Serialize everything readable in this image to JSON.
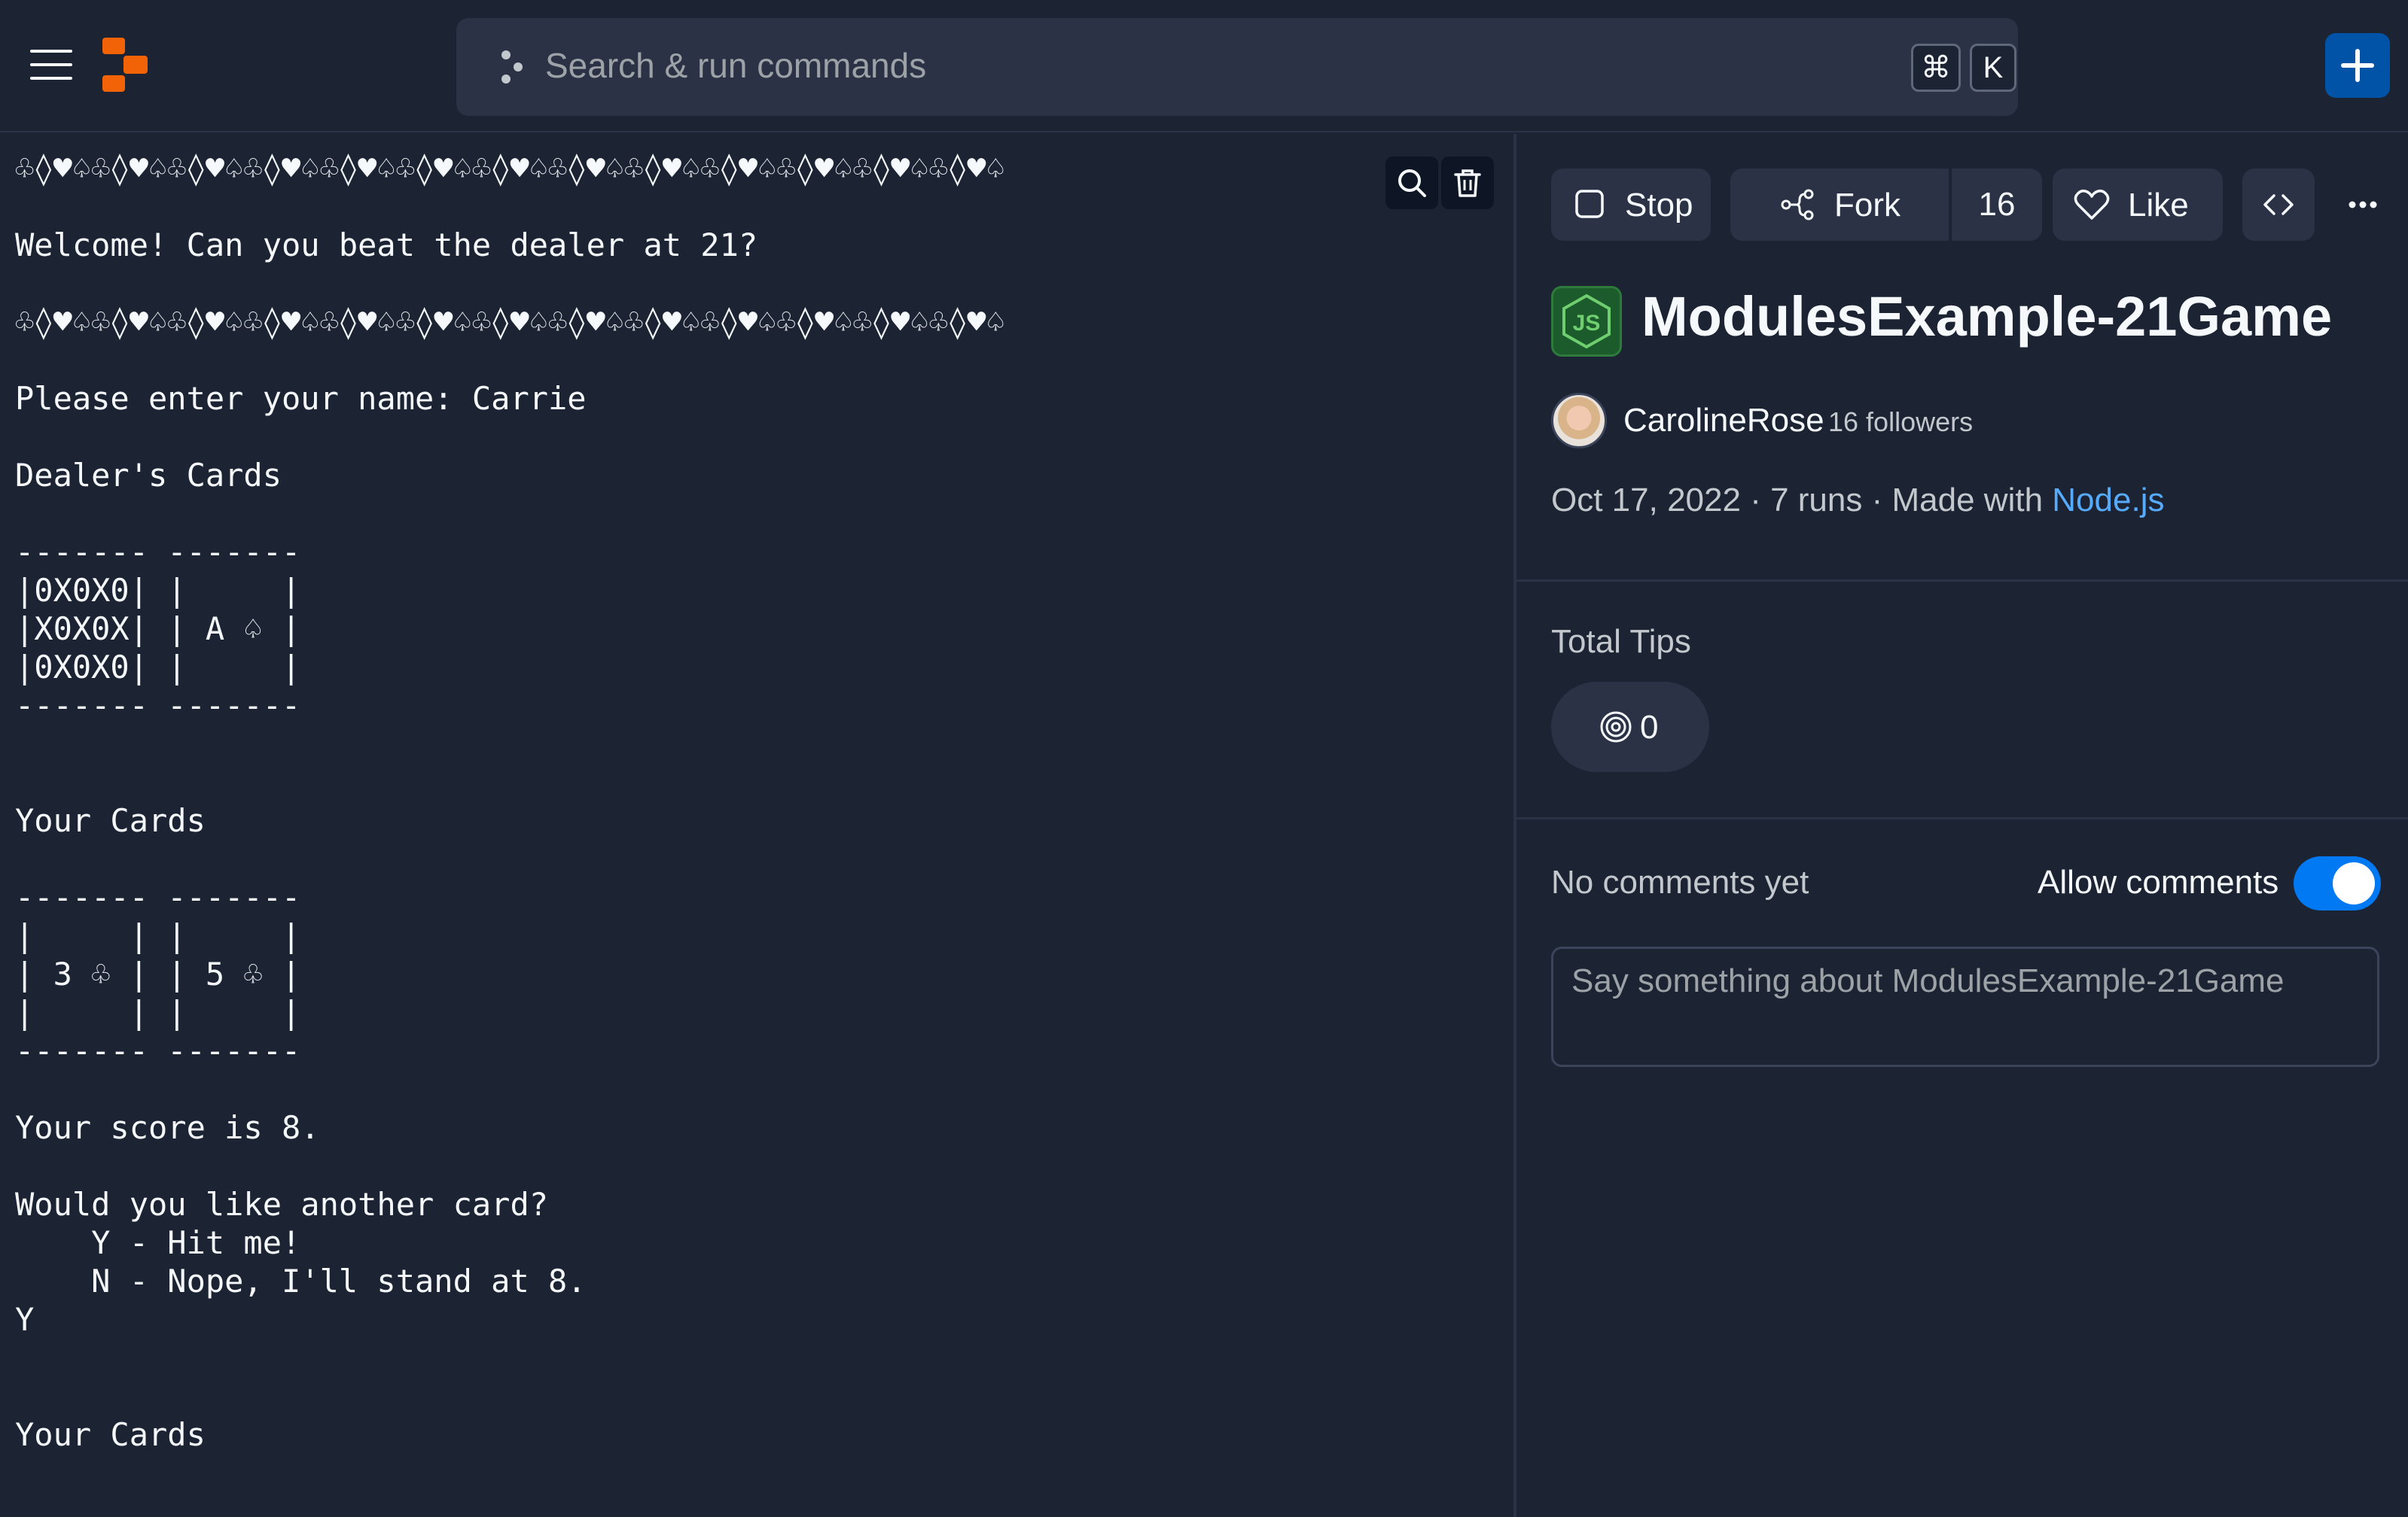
{
  "header": {
    "search_placeholder": "Search & run commands",
    "shortcut_keys": [
      "⌘",
      "K"
    ]
  },
  "console": {
    "text": "♧◊♥♤♧◊♥♤♧◊♥♤♧◊♥♤♧◊♥♤♧◊♥♤♧◊♥♤♧◊♥♤♧◊♥♤♧◊♥♤♧◊♥♤♧◊♥♤♧◊♥♤\n\nWelcome! Can you beat the dealer at 21?\n\n♧◊♥♤♧◊♥♤♧◊♥♤♧◊♥♤♧◊♥♤♧◊♥♤♧◊♥♤♧◊♥♤♧◊♥♤♧◊♥♤♧◊♥♤♧◊♥♤♧◊♥♤\n\nPlease enter your name: Carrie\n\nDealer's Cards\n\n------- -------\n|0X0X0| |     |\n|X0X0X| | A ♤ |\n|0X0X0| |     |\n------- -------\n\n\nYour Cards\n\n------- -------\n|     | |     |\n| 3 ♧ | | 5 ♧ |\n|     | |     |\n------- -------\n\nYour score is 8.\n\nWould you like another card?\n    Y - Hit me!\n    N - Nope, I'll stand at 8.\nY\n\n\nYour Cards"
  },
  "actions": {
    "stop_label": "Stop",
    "fork_label": "Fork",
    "fork_count": "16",
    "like_label": "Like"
  },
  "repl": {
    "title": "ModulesExample-21Game",
    "author": "CarolineRose",
    "followers": "16 followers",
    "date": "Oct 17, 2022",
    "separator": "·",
    "runs": "7 runs",
    "made_with_prefix": "Made with",
    "language": "Node.js"
  },
  "tips": {
    "label": "Total Tips",
    "value": "0"
  },
  "comments": {
    "empty_text": "No comments yet",
    "allow_label": "Allow comments",
    "allow_enabled": true,
    "placeholder": "Say something about ModulesExample-21Game"
  },
  "colors": {
    "background": "#1c2333",
    "surface": "#2b3245",
    "accent_blue": "#0079f2",
    "link": "#57abff",
    "logo_orange": "#f26207",
    "node_green": "#1c5b2b"
  }
}
